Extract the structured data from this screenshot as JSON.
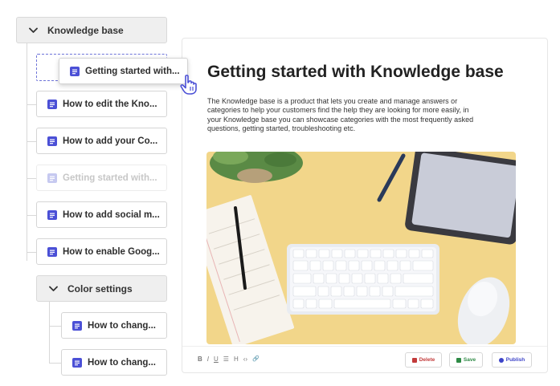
{
  "sidebar": {
    "folder_root": {
      "label": "Knowledge base"
    },
    "items": [
      {
        "label": "How to edit the Kno..."
      },
      {
        "label": "How to add your Co..."
      },
      {
        "label": "Getting started with..."
      },
      {
        "label": "How to add social m..."
      },
      {
        "label": "How to enable Goog..."
      }
    ],
    "subfolder": {
      "label": "Color settings",
      "items": [
        {
          "label": "How to chang..."
        },
        {
          "label": "How to chang..."
        }
      ]
    },
    "dragging_item": {
      "label": "Getting started with..."
    }
  },
  "article": {
    "title": "Getting started with Knowledge base",
    "body_lines": [
      "The Knowledge base is a product that lets you create and manage answers or",
      "categories to help your customers find the help they are looking for more easily, in",
      "your Knowledge base you can showcase categories with the most frequently asked",
      "questions, getting started, troubleshooting etc."
    ]
  },
  "toolbar": {
    "format_buttons": [
      "B",
      "I",
      "U",
      "☰",
      "H",
      "‹›",
      "🔗"
    ],
    "delete_label": "Delete",
    "save_label": "Save",
    "publish_label": "Publish"
  },
  "colors": {
    "accent": "#4b50d6",
    "delete": "#c23a3a",
    "save": "#2e8a45",
    "publish": "#3d44c8",
    "photo_background": "#f2d68a"
  },
  "icons": {
    "doc": "document-icon",
    "folder_toggle": "chevron-down-icon",
    "cursor": "hand-pointer-icon"
  }
}
